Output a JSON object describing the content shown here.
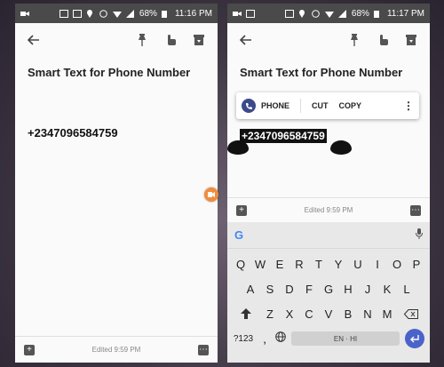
{
  "left": {
    "status": {
      "battery": "68%",
      "time": "11:16 PM"
    },
    "note": {
      "title": "Smart Text for Phone Number",
      "body": "+2347096584759"
    },
    "bottom": {
      "edited": "Edited 9:59 PM"
    }
  },
  "right": {
    "status": {
      "battery": "68%",
      "time": "11:17 PM"
    },
    "note": {
      "title": "Smart Text for Phone Number",
      "selected": "+2347096584759"
    },
    "menu": {
      "phone": "PHONE",
      "cut": "CUT",
      "copy": "COPY"
    },
    "bottom": {
      "edited": "Edited 9:59 PM"
    },
    "keyboard": {
      "row1": [
        "Q",
        "W",
        "E",
        "R",
        "T",
        "Y",
        "U",
        "I",
        "O",
        "P"
      ],
      "row2": [
        "A",
        "S",
        "D",
        "F",
        "G",
        "H",
        "J",
        "K",
        "L"
      ],
      "row3": [
        "Z",
        "X",
        "C",
        "V",
        "B",
        "N",
        "M"
      ],
      "num_label": "?123",
      "comma": ",",
      "language": "EN · HI"
    }
  },
  "colors": {
    "status_bar": "#4a4a4a",
    "accent": "#4a63c9",
    "phone_icon": "#3b4a8b",
    "badge": "#f28c3b"
  }
}
